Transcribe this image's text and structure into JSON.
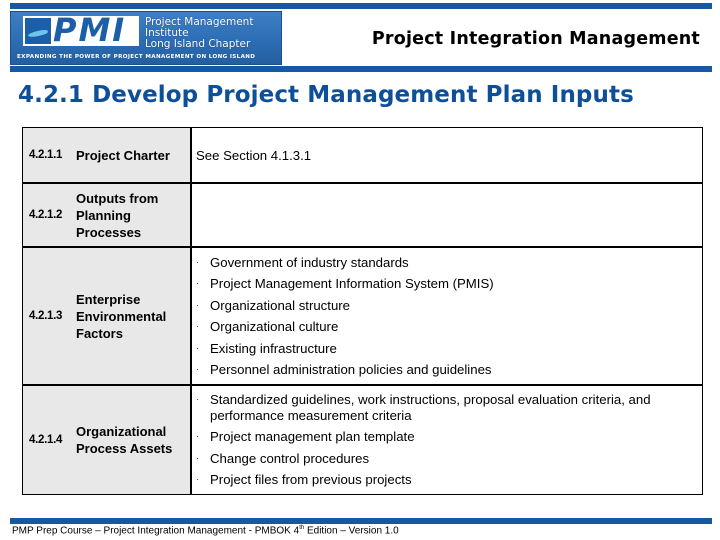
{
  "header": {
    "logo": {
      "mark_text": "PMI",
      "org_name_line1": "Project Management Institute",
      "org_name_line2": "Long Island Chapter",
      "tagline": "Expanding the Power of Project Management on Long Island"
    },
    "title": "Project Integration Management"
  },
  "page": {
    "heading": "4.2.1 Develop Project Management Plan Inputs"
  },
  "table": {
    "rows": [
      {
        "number": "4.2.1.1",
        "name": "Project Charter",
        "content": "See Section 4.1.3.1",
        "items": []
      },
      {
        "number": "4.2.1.2",
        "name": "Outputs from Planning Processes",
        "content": "",
        "items": []
      },
      {
        "number": "4.2.1.3",
        "name": "Enterprise Environmental Factors",
        "content": "",
        "items": [
          "Government of industry standards",
          "Project Management Information System (PMIS)",
          "Organizational structure",
          "Organizational culture",
          "Existing infrastructure",
          "Personnel administration policies and guidelines"
        ]
      },
      {
        "number": "4.2.1.4",
        "name": "Organizational Process Assets",
        "content": "",
        "items": [
          "Standardized guidelines, work instructions, proposal evaluation criteria, and performance measurement criteria",
          "Project management plan template",
          "Change control procedures",
          "Project files from previous projects"
        ]
      }
    ],
    "bullet_glyph": "·"
  },
  "footer": {
    "text_before_sup": "PMP Prep Course – Project Integration Management - PMBOK 4",
    "sup": "th",
    "text_after_sup": " Edition – Version 1.0"
  },
  "colors": {
    "brand_blue": "#1559a4",
    "heading_blue": "#0e4f9a",
    "label_cell_bg": "#e8e8e8"
  }
}
